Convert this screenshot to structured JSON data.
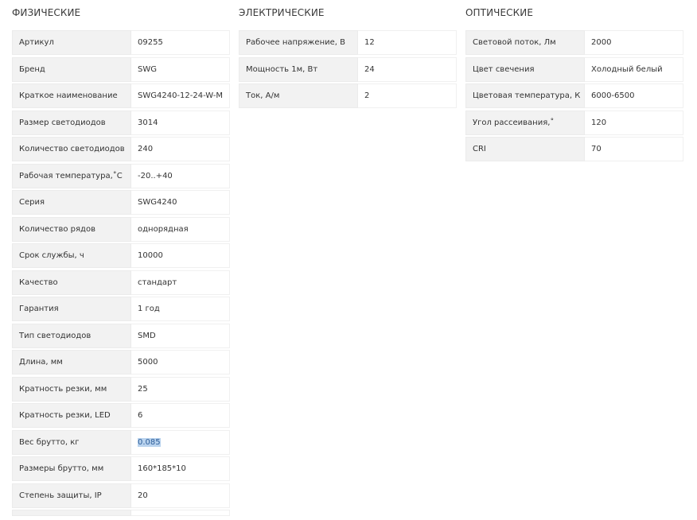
{
  "sections": {
    "physical": {
      "title": "ФИЗИЧЕСКИЕ",
      "rows": [
        {
          "label": "Артикул",
          "value": "09255"
        },
        {
          "label": "Бренд",
          "value": "SWG"
        },
        {
          "label": "Краткое наименование",
          "value": "SWG4240-12-24-W-M"
        },
        {
          "label": "Размер светодиодов",
          "value": "3014"
        },
        {
          "label": "Количество светодиодов",
          "value": "240"
        },
        {
          "label": "Рабочая температура,˚С",
          "value": "-20..+40"
        },
        {
          "label": "Серия",
          "value": "SWG4240"
        },
        {
          "label": "Количество рядов",
          "value": "однорядная"
        },
        {
          "label": "Срок службы, ч",
          "value": "10000"
        },
        {
          "label": "Качество",
          "value": "стандарт"
        },
        {
          "label": "Гарантия",
          "value": "1 год"
        },
        {
          "label": "Тип светодиодов",
          "value": "SMD"
        },
        {
          "label": "Длина, мм",
          "value": "5000"
        },
        {
          "label": "Кратность резки, мм",
          "value": "25"
        },
        {
          "label": "Кратность резки, LED",
          "value": "6"
        },
        {
          "label": "Вес брутто, кг",
          "value": "0.085"
        },
        {
          "label": "Размеры брутто, мм",
          "value": "160*185*10"
        },
        {
          "label": "Степень защиты, IP",
          "value": "20"
        }
      ]
    },
    "electrical": {
      "title": "ЭЛЕКТРИЧЕСКИЕ",
      "rows": [
        {
          "label": "Рабочее напряжение, В",
          "value": "12"
        },
        {
          "label": "Мощность 1м, Вт",
          "value": "24"
        },
        {
          "label": "Ток, А/м",
          "value": "2"
        }
      ]
    },
    "optical": {
      "title": "ОПТИЧЕСКИЕ",
      "rows": [
        {
          "label": "Световой поток, Лм",
          "value": "2000"
        },
        {
          "label": "Цвет свечения",
          "value": "Холодный белый"
        },
        {
          "label": "Цветовая температура, К",
          "value": "6000-6500"
        },
        {
          "label": "Угол рассеивания,˚",
          "value": "120"
        },
        {
          "label": "CRI",
          "value": "70"
        }
      ]
    }
  },
  "selection": {
    "section": "physical",
    "row_index": 15,
    "highlight_color": "#b9d3ee"
  }
}
